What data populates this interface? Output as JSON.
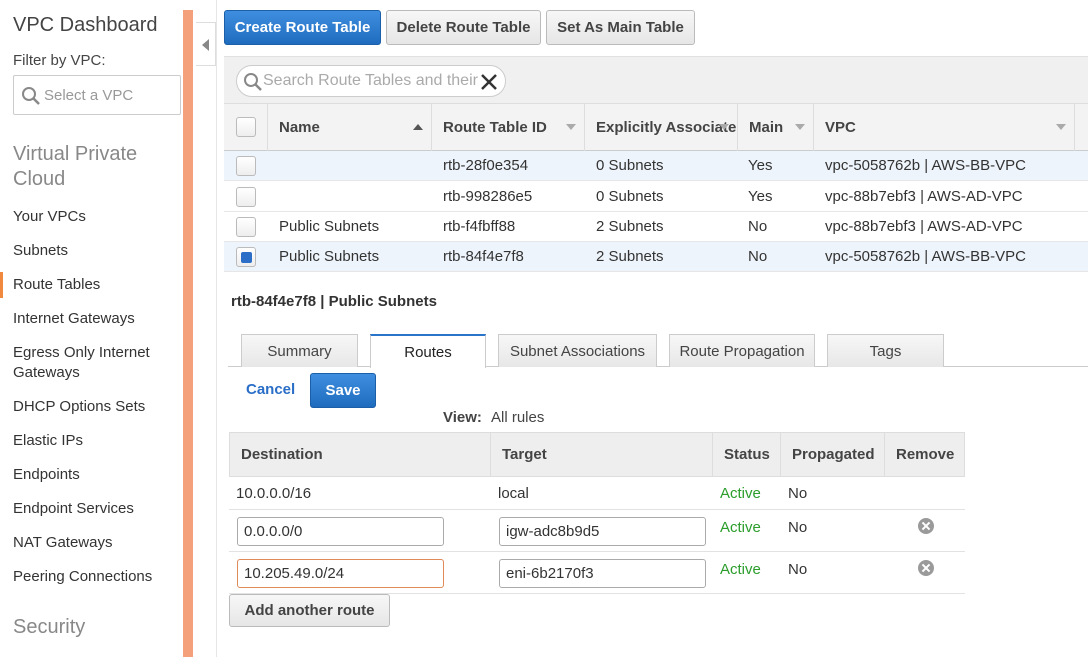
{
  "sidebar": {
    "title": "VPC Dashboard",
    "filter_label": "Filter by VPC:",
    "filter_placeholder": "Select a VPC",
    "section_vpc": "Virtual Private Cloud",
    "items": [
      {
        "label": "Your VPCs"
      },
      {
        "label": "Subnets"
      },
      {
        "label": "Route Tables",
        "active": true
      },
      {
        "label": "Internet Gateways"
      },
      {
        "label": "Egress Only Internet Gateways"
      },
      {
        "label": "DHCP Options Sets"
      },
      {
        "label": "Elastic IPs"
      },
      {
        "label": "Endpoints"
      },
      {
        "label": "Endpoint Services"
      },
      {
        "label": "NAT Gateways"
      },
      {
        "label": "Peering Connections"
      }
    ],
    "section_security": "Security"
  },
  "toolbar": {
    "create_label": "Create Route Table",
    "delete_label": "Delete Route Table",
    "set_main_label": "Set As Main Table"
  },
  "search": {
    "placeholder": "Search Route Tables and their"
  },
  "grid": {
    "columns": [
      "Name",
      "Route Table ID",
      "Explicitly Associated With",
      "Main",
      "VPC"
    ],
    "rows": [
      {
        "name": "",
        "id": "rtb-28f0e354",
        "assoc": "0 Subnets",
        "main": "Yes",
        "vpc": "vpc-5058762b | AWS-BB-VPC",
        "selected": false
      },
      {
        "name": "",
        "id": "rtb-998286e5",
        "assoc": "0 Subnets",
        "main": "Yes",
        "vpc": "vpc-88b7ebf3 | AWS-AD-VPC",
        "selected": false
      },
      {
        "name": "Public Subnets",
        "id": "rtb-f4fbff88",
        "assoc": "2 Subnets",
        "main": "No",
        "vpc": "vpc-88b7ebf3 | AWS-AD-VPC",
        "selected": false
      },
      {
        "name": "Public Subnets",
        "id": "rtb-84f4e7f8",
        "assoc": "2 Subnets",
        "main": "No",
        "vpc": "vpc-5058762b | AWS-BB-VPC",
        "selected": true
      }
    ]
  },
  "detail": {
    "title": "rtb-84f4e7f8 | Public Subnets",
    "tabs": [
      "Summary",
      "Routes",
      "Subnet Associations",
      "Route Propagation",
      "Tags"
    ],
    "active_tab": "Routes",
    "cancel_label": "Cancel",
    "save_label": "Save",
    "view_label": "View:",
    "view_value": "All rules",
    "route_columns": [
      "Destination",
      "Target",
      "Status",
      "Propagated",
      "Remove"
    ],
    "routes": [
      {
        "destination": "10.0.0.0/16",
        "target": "local",
        "status": "Active",
        "propagated": "No",
        "editable": false
      },
      {
        "destination": "0.0.0.0/0",
        "target": "igw-adc8b9d5",
        "status": "Active",
        "propagated": "No",
        "editable": true
      },
      {
        "destination": "10.205.49.0/24",
        "target": "eni-6b2170f3",
        "status": "Active",
        "propagated": "No",
        "editable": true
      }
    ],
    "add_route_label": "Add another route"
  },
  "colors": {
    "primary_button": "#1f6cbf",
    "sidebar_accent": "#f4a07a",
    "status_active": "#2a9d2a",
    "link": "#2a6ec7"
  },
  "icons": [
    "search-icon",
    "clear-icon",
    "collapse-icon",
    "sort-icon",
    "remove-icon"
  ]
}
